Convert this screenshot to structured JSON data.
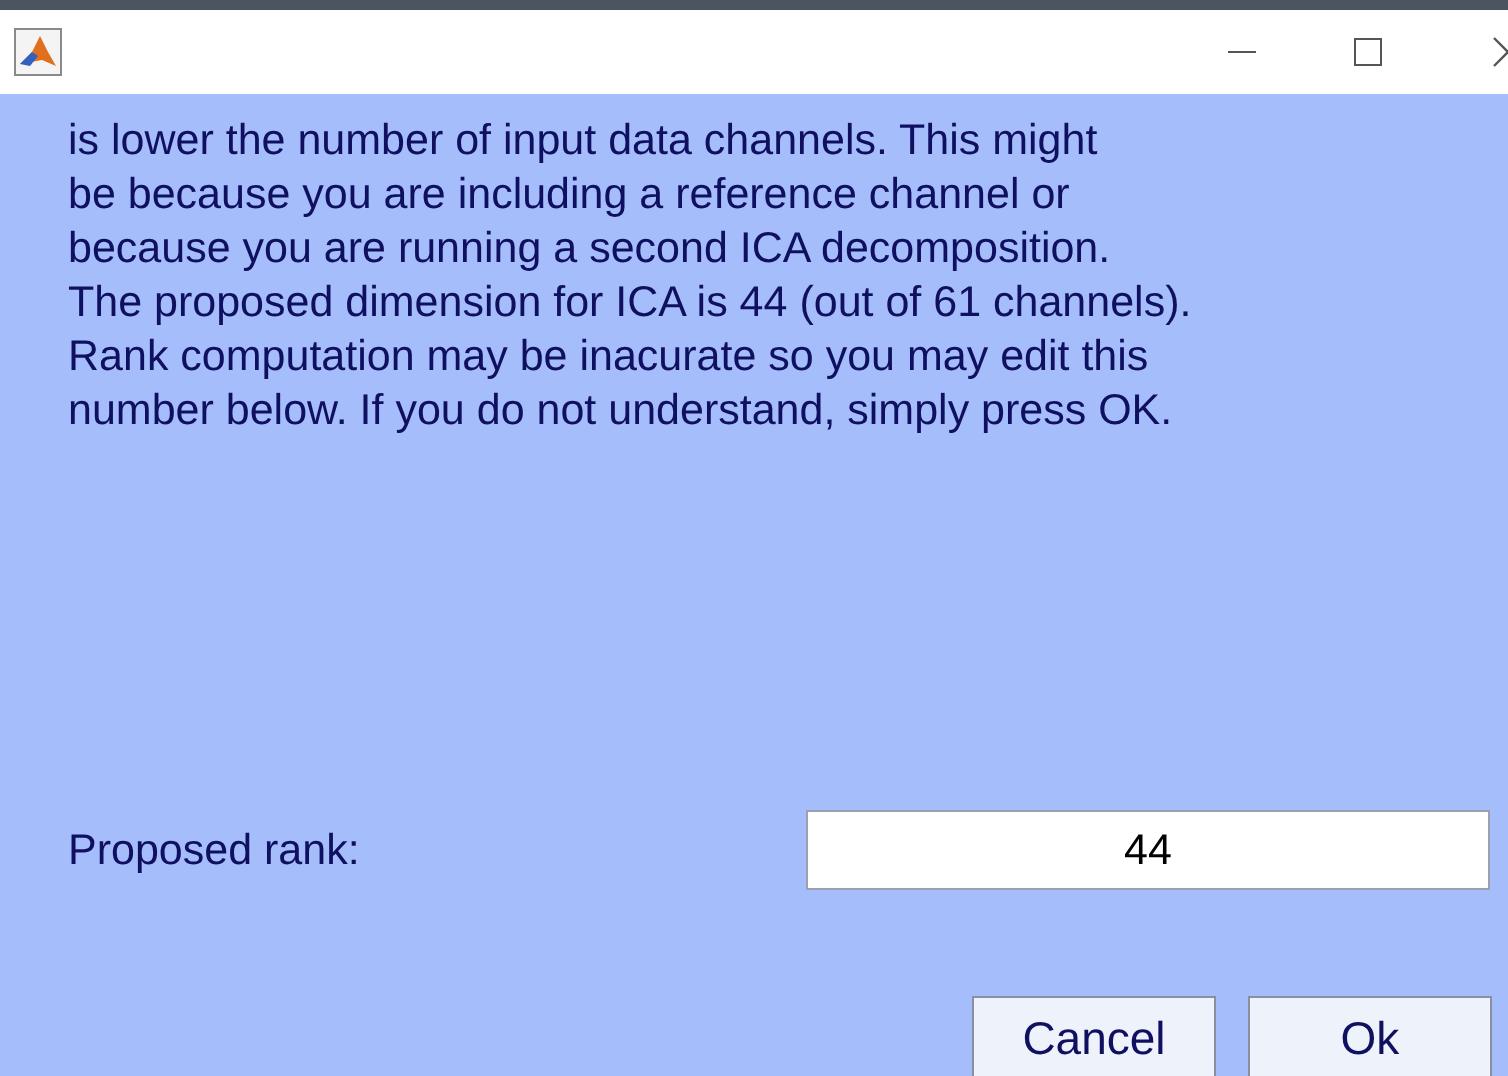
{
  "window": {
    "controls": [
      {
        "kind": "minimize"
      },
      {
        "kind": "maximize"
      },
      {
        "kind": "close"
      }
    ]
  },
  "message_lines": [
    "is lower the number of input data channels. This might",
    "be because you are including a reference channel or",
    "because you are running a second ICA decomposition.",
    "The proposed dimension for ICA is 44 (out of 61 channels).",
    "Rank computation may be inacurate so you may edit this",
    "number below. If you do not understand, simply press OK."
  ],
  "rank_field": {
    "label": "Proposed rank:",
    "value": "44"
  },
  "buttons": [
    "Cancel",
    "Ok"
  ]
}
